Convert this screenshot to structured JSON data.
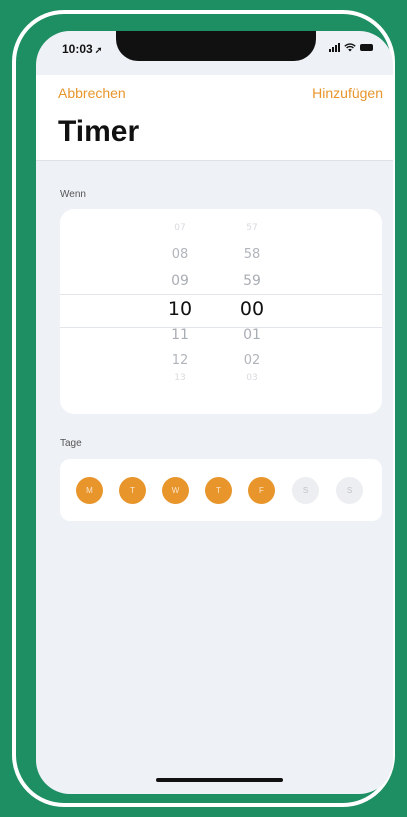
{
  "status_bar": {
    "time": "10:03",
    "location_glyph": "➚"
  },
  "nav": {
    "cancel_label": "Abbrechen",
    "add_label": "Hinzufügen"
  },
  "title": "Timer",
  "when_section": {
    "label": "Wenn"
  },
  "picker": {
    "hours": [
      "07",
      "08",
      "09",
      "10",
      "11",
      "12",
      "13"
    ],
    "minutes": [
      "57",
      "58",
      "59",
      "00",
      "01",
      "02",
      "03"
    ],
    "selected_hour": "10",
    "selected_minute": "00"
  },
  "days_section": {
    "label": "Tage",
    "days": [
      {
        "label": "M",
        "selected": true
      },
      {
        "label": "T",
        "selected": true
      },
      {
        "label": "W",
        "selected": true
      },
      {
        "label": "T",
        "selected": true
      },
      {
        "label": "F",
        "selected": true
      },
      {
        "label": "S",
        "selected": false
      },
      {
        "label": "S",
        "selected": false
      }
    ]
  },
  "colors": {
    "accent": "#e8952c",
    "frame": "#1e8f63",
    "background": "#eef1f6"
  }
}
